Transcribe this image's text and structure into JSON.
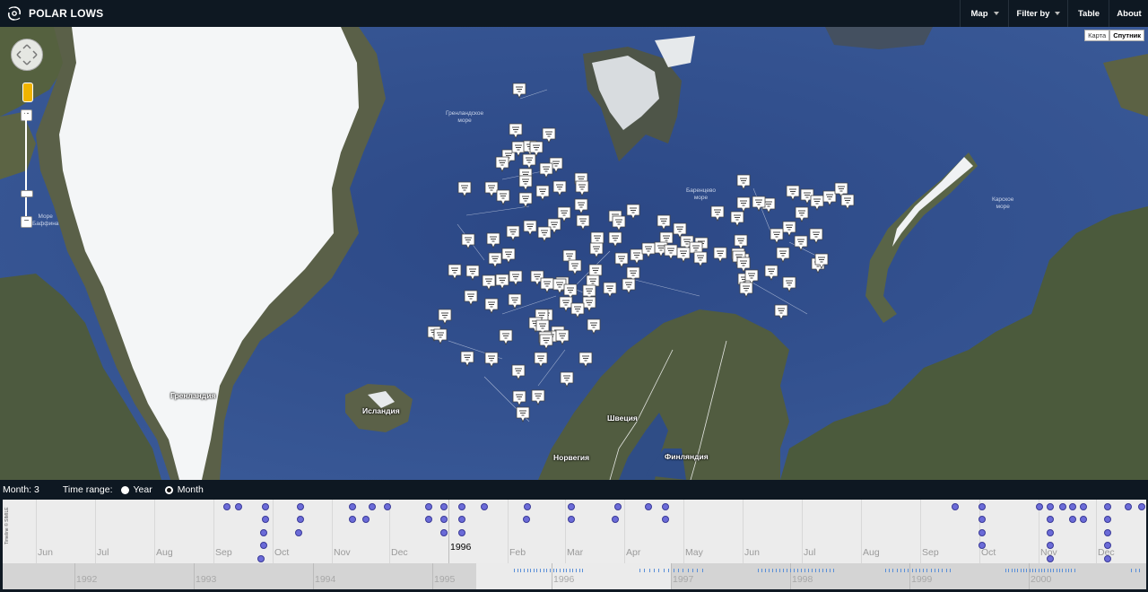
{
  "navbar": {
    "title": "POLAR LOWS",
    "items": [
      {
        "label": "Map",
        "dropdown": true
      },
      {
        "label": "Filter by",
        "dropdown": true
      },
      {
        "label": "Table",
        "dropdown": false
      },
      {
        "label": "About",
        "dropdown": false
      }
    ]
  },
  "map": {
    "type_buttons": [
      "Карта",
      "Спутник"
    ],
    "active_type": "Спутник",
    "labels": {
      "greenland": "Гренландия",
      "iceland": "Исландия",
      "sweden": "Швеция",
      "norway": "Норвегия",
      "finland": "Финляндия"
    },
    "sea_labels": {
      "greenland_sea_1": "Гренландское",
      "greenland_sea_2": "море",
      "barents_sea_1": "Баренцево",
      "barents_sea_2": "море",
      "kara_sea_1": "Карское",
      "kara_sea_2": "море",
      "baffin_1": "Море",
      "baffin_2": "Баффина"
    },
    "marker_icon": "polar-low-marker-icon",
    "zoom_in": "+",
    "zoom_out": "−",
    "close_symbol": "✖"
  },
  "timeline": {
    "month_text": "Month: 3",
    "range_label": "Time range:",
    "options": [
      {
        "label": "Year",
        "selected": false
      },
      {
        "label": "Month",
        "selected": true
      }
    ],
    "month_labels": [
      "Jun",
      "Jul",
      "Aug",
      "Sep",
      "Oct",
      "Nov",
      "Dec",
      "1996",
      "Feb",
      "Mar",
      "Apr",
      "May",
      "Jun",
      "Jul",
      "Aug",
      "Sep",
      "Oct",
      "Nov",
      "Dec"
    ],
    "overview_years": [
      "1992",
      "1993",
      "1994",
      "1995",
      "1996",
      "1997",
      "1998",
      "1999",
      "2000"
    ],
    "credit": "Timeline © SIMILE",
    "colors": {
      "dot": "#6b6bd8",
      "tick": "#5a8fd8"
    }
  }
}
